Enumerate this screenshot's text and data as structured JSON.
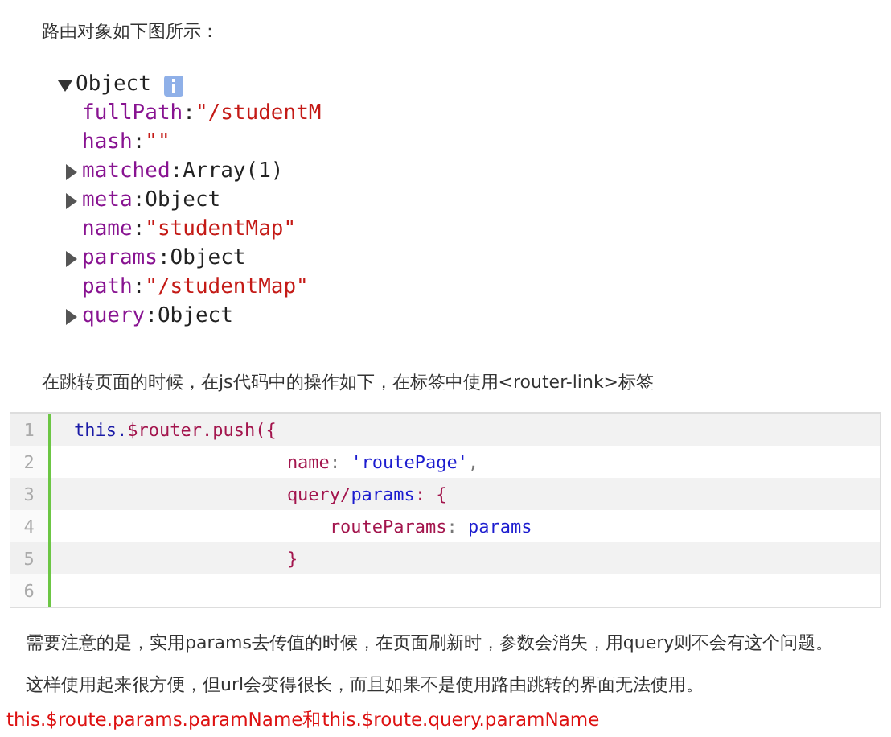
{
  "intro": "路由对象如下图所示：",
  "object_dump": {
    "label": "Object",
    "expanded": true,
    "rows": [
      {
        "key": "fullPath",
        "separator": ":",
        "value": "\"/studentM",
        "kind": "string",
        "expandable": false
      },
      {
        "key": "hash",
        "separator": ":",
        "value": "\"\"",
        "kind": "string",
        "expandable": false
      },
      {
        "key": "matched",
        "separator": ":",
        "value": "Array(1)",
        "kind": "object",
        "expandable": true
      },
      {
        "key": "meta",
        "separator": ":",
        "value": "Object",
        "kind": "object",
        "expandable": true
      },
      {
        "key": "name",
        "separator": ":",
        "value": "\"studentMap\"",
        "kind": "string",
        "expandable": false
      },
      {
        "key": "params",
        "separator": ":",
        "value": "Object",
        "kind": "object",
        "expandable": true
      },
      {
        "key": "path",
        "separator": ":",
        "value": "\"/studentMap\"",
        "kind": "string",
        "expandable": false
      },
      {
        "key": "query",
        "separator": ":",
        "value": "Object",
        "kind": "object",
        "expandable": true
      }
    ]
  },
  "paragraph_2": "在跳转页面的时候，在js代码中的操作如下，在标签中使用<router-link>标签",
  "code_block": {
    "lines": [
      {
        "number": "1",
        "tokens": [
          {
            "text": "this.",
            "kind": "keyword"
          },
          {
            "text": "$router.push({",
            "kind": "plain"
          }
        ]
      },
      {
        "number": "2",
        "tokens": [
          {
            "text": "name",
            "kind": "plain"
          },
          {
            "text": ": ",
            "kind": "punct"
          },
          {
            "text": "'routePage'",
            "kind": "value"
          },
          {
            "text": ",",
            "kind": "punct"
          }
        ]
      },
      {
        "number": "3",
        "tokens": [
          {
            "text": "query/",
            "kind": "plain"
          },
          {
            "text": "params",
            "kind": "value"
          },
          {
            "text": ": {",
            "kind": "plain"
          }
        ]
      },
      {
        "number": "4",
        "tokens": [
          {
            "text": "routeParams",
            "kind": "plain"
          },
          {
            "text": ": ",
            "kind": "punct"
          },
          {
            "text": "params",
            "kind": "value"
          }
        ]
      },
      {
        "number": "5",
        "tokens": [
          {
            "text": "}",
            "kind": "plain"
          }
        ]
      },
      {
        "number": "6"
      }
    ]
  },
  "paragraph_3": "需要注意的是，实用params去传值的时候，在页面刷新时，参数会消失，用query则不会有这个问题。",
  "paragraph_4": "这样使用起来很方便，但url会变得很长，而且如果不是使用路由跳转的界面无法使用。",
  "highlight_line": "this.$route.params.paramName和this.$route.query.paramName"
}
